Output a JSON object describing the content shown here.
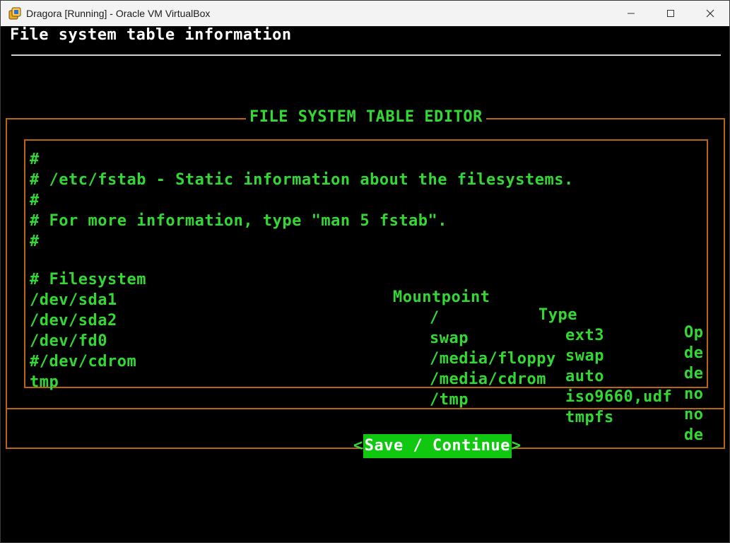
{
  "window": {
    "title": "Dragora [Running] - Oracle VM VirtualBox",
    "icon": "virtualbox-icon",
    "controls": [
      "minimize-icon",
      "maximize-icon",
      "close-icon"
    ]
  },
  "header": {
    "title": "File system table information"
  },
  "dialog": {
    "title": "FILE SYSTEM TABLE EDITOR",
    "comments": [
      "#",
      "# /etc/fstab - Static information about the filesystems.",
      "#",
      "# For more information, type \"man 5 fstab\".",
      "#"
    ],
    "columns": {
      "filesystem": "# Filesystem",
      "mountpoint": "Mountpoint",
      "type": "Type",
      "options": "Op"
    },
    "rows": [
      {
        "filesystem": "/dev/sda1",
        "mountpoint": "/",
        "type": "ext3",
        "options": "de"
      },
      {
        "filesystem": "/dev/sda2",
        "mountpoint": "swap",
        "type": "swap",
        "options": "de"
      },
      {
        "filesystem": "/dev/fd0",
        "mountpoint": "/media/floppy",
        "type": "auto",
        "options": "no"
      },
      {
        "filesystem": "#/dev/cdrom",
        "mountpoint": "/media/cdrom",
        "type": "iso9660,udf",
        "options": "no"
      },
      {
        "filesystem": "tmp",
        "mountpoint": "/tmp",
        "type": "tmpfs",
        "options": "de"
      }
    ],
    "button": {
      "left_bracket": "<",
      "label": "Save / Continue",
      "right_bracket": ">"
    }
  },
  "colors": {
    "text_green": "#34d834",
    "border_orange": "#b96410",
    "button_bg": "#10c810"
  }
}
